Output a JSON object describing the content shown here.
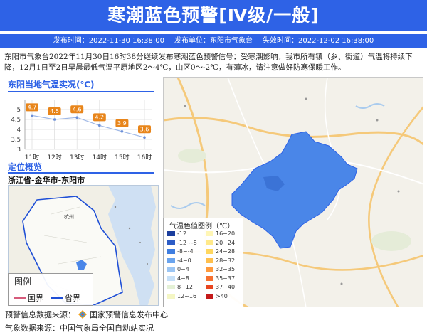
{
  "header": {
    "title": "寒潮蓝色预警[Ⅳ级/一般]",
    "publish_time": "发布时间：2022-11-30 16:38:00",
    "publisher": "发布单位：东阳市气象台",
    "expire_time": "失效时间：2022-12-02 16:38:00"
  },
  "description": "东阳市气象台2022年11月30日16时38分继续发布寒潮蓝色预警信号：受寒潮影响，我市所有镇（乡、街道）气温将持续下降，12月1日至2日早晨最低气温平原地区2～4℃，山区0～-2℃，有薄冰，请注意做好防寒保暖工作。",
  "temperature_panel": {
    "title": "东阳当地气温实况(℃)"
  },
  "chart_data": {
    "type": "line",
    "title": "东阳当地气温实况(℃)",
    "categories": [
      "11时",
      "12时",
      "13时",
      "14时",
      "15时",
      "16时"
    ],
    "values": [
      4.7,
      4.5,
      4.6,
      4.2,
      3.9,
      3.6
    ],
    "value_labels": [
      "4.7",
      "4.5",
      "4.6",
      "4.2",
      "3.9",
      "3.6"
    ],
    "yticks": [
      "5",
      "4.5",
      "4",
      "3.5",
      "3"
    ],
    "ylim": [
      3,
      5.5
    ],
    "label_color": "#e8851a",
    "grid": true
  },
  "location": {
    "title": "定位概览",
    "path": "浙江省-金华市-东阳市",
    "city_label": "杭州"
  },
  "mini_map_legend": {
    "title": "图例",
    "items": [
      "国界",
      "省界"
    ]
  },
  "temp_legend": {
    "title": "气温色值图例（℃）",
    "items": [
      {
        "label": "-12",
        "color": "#1c3f9e"
      },
      {
        "label": "16~20",
        "color": "#fff6b5"
      },
      {
        "label": "-12~-8",
        "color": "#2c5cc6"
      },
      {
        "label": "20~24",
        "color": "#ffe98a"
      },
      {
        "label": "-8~-4",
        "color": "#3f7ee0"
      },
      {
        "label": "24~28",
        "color": "#ffd75e"
      },
      {
        "label": "-4~0",
        "color": "#6aa4ee"
      },
      {
        "label": "28~32",
        "color": "#ffc04d"
      },
      {
        "label": "0~4",
        "color": "#9cc6f4"
      },
      {
        "label": "32~35",
        "color": "#ff9a3c"
      },
      {
        "label": "4~8",
        "color": "#c6e0f8"
      },
      {
        "label": "35~37",
        "color": "#f6702f"
      },
      {
        "label": "8~12",
        "color": "#e4f1d6"
      },
      {
        "label": "37~40",
        "color": "#e8461f"
      },
      {
        "label": "12~16",
        "color": "#f4f6c4"
      },
      {
        "label": ">40",
        "color": "#c41a1a"
      }
    ]
  },
  "footer": {
    "warning_source_label": "预警信息数据来源：",
    "warning_source": "国家预警信息发布中心",
    "weather_source": "气象数据来源：中国气象局全国自动站实况"
  },
  "colors": {
    "primary": "#2e62e6",
    "county_fill": "#4a86e8"
  }
}
